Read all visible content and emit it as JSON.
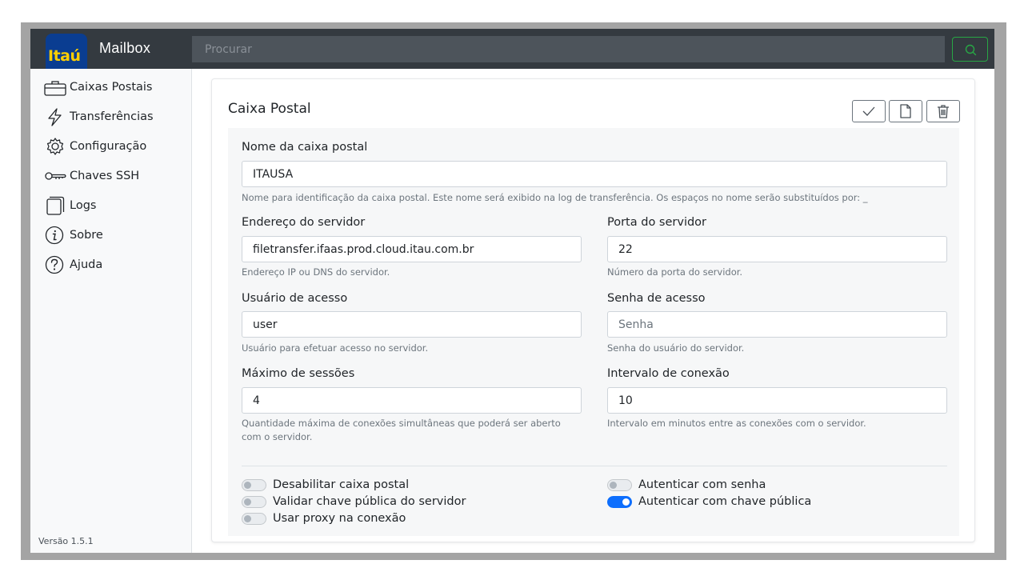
{
  "header": {
    "logo_text": "Itaú",
    "app_title": "Mailbox",
    "search_placeholder": "Procurar"
  },
  "sidebar": {
    "items": [
      {
        "label": "Caixas Postais",
        "icon": "mailbox-icon"
      },
      {
        "label": "Transferências",
        "icon": "lightning-icon"
      },
      {
        "label": "Configuração",
        "icon": "gear-icon"
      },
      {
        "label": "Chaves SSH",
        "icon": "key-icon"
      },
      {
        "label": "Logs",
        "icon": "files-icon"
      },
      {
        "label": "Sobre",
        "icon": "info-icon"
      },
      {
        "label": "Ajuda",
        "icon": "question-icon"
      }
    ],
    "version": "Versão 1.5.1"
  },
  "card": {
    "title": "Caixa Postal",
    "toolbar": [
      "check-icon",
      "file-icon",
      "trash-icon"
    ]
  },
  "form": {
    "name": {
      "label": "Nome da caixa postal",
      "value": "ITAUSA",
      "help": "Nome para identificação da caixa postal. Este nome será exibido na log de transferência. Os espaços no nome serão substituídos por: _"
    },
    "server_address": {
      "label": "Endereço do servidor",
      "value": "filetransfer.ifaas.prod.cloud.itau.com.br",
      "help": "Endereço IP ou DNS do servidor."
    },
    "server_port": {
      "label": "Porta do servidor",
      "value": "22",
      "help": "Número da porta do servidor."
    },
    "username": {
      "label": "Usuário de acesso",
      "value": "user",
      "help": "Usuário para efetuar acesso no servidor."
    },
    "password": {
      "label": "Senha de acesso",
      "placeholder": "Senha",
      "help": "Senha do usuário do servidor."
    },
    "max_sessions": {
      "label": "Máximo de sessões",
      "value": "4",
      "help_line1": "Quantidade máxima de conexões simultâneas que poderá ser aberto",
      "help_line2": "com o servidor."
    },
    "interval": {
      "label": "Intervalo de conexão",
      "value": "10",
      "help": "Intervalo em minutos entre as conexões com o servidor."
    }
  },
  "switches": [
    {
      "label": "Desabilitar caixa postal",
      "on": false
    },
    {
      "label": "Validar chave pública do servidor",
      "on": false
    },
    {
      "label": "Usar proxy na conexão",
      "on": false
    },
    {
      "label": "Autenticar com senha",
      "on": false
    },
    {
      "label": "Autenticar com chave pública",
      "on": true
    }
  ],
  "colors": {
    "topbar": "#343a40",
    "search_button_border": "#28a745",
    "switch_on": "#0d6efd",
    "logo_bg": "#0a3d91",
    "logo_text": "#ffcf00"
  }
}
